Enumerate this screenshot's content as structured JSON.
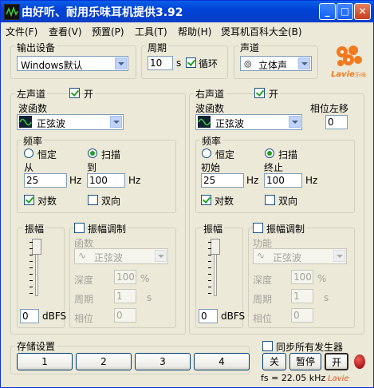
{
  "window": {
    "title": "由好听、耐用乐味耳机提供3.92"
  },
  "menu": [
    "文件(F)",
    "查看(V)",
    "预置(P)",
    "工具(T)",
    "帮助(H)",
    "煲耳机百科大全(B)"
  ],
  "output_device": {
    "group_label": "输出设备",
    "value": "Windows默认"
  },
  "period": {
    "group_label": "周期",
    "value": "10",
    "unit": "s",
    "loop_label": "循环",
    "loop_checked": true
  },
  "channel": {
    "group_label": "声道",
    "value": "立体声"
  },
  "logo": {
    "text": "Lavie",
    "small": "乐味"
  },
  "left": {
    "group_label": "左声道",
    "on_label": "开",
    "on_checked": true,
    "waveform_label": "波函数",
    "waveform_value": "正弦波",
    "freq_label": "频率",
    "const_label": "恒定",
    "sweep_label": "扫描",
    "sweep_selected": true,
    "from_label": "从",
    "to_label": "到",
    "from_value": "25",
    "to_value": "100",
    "hz": "Hz",
    "log_label": "对数",
    "log_checked": true,
    "bidir_label": "双向",
    "bidir_checked": false,
    "amp_label": "振幅",
    "amp_value": "0",
    "dbfs": "dBFS",
    "ampmod_label": "振幅调制",
    "ampmod_checked": false,
    "func_label": "函数",
    "func_value": "正弦波",
    "depth_label": "深度",
    "depth_value": "100",
    "percent": "%",
    "mperiod_label": "周期",
    "mperiod_value": "1",
    "s": "s",
    "phase_label": "相位",
    "phase_value": "0"
  },
  "right": {
    "group_label": "右声道",
    "on_label": "开",
    "on_checked": true,
    "waveform_label": "波函数",
    "waveform_value": "正弦波",
    "phase_shift_label": "相位左移",
    "phase_shift_value": "0",
    "freq_label": "频率",
    "const_label": "恒定",
    "sweep_label": "扫描",
    "sweep_selected": true,
    "from_label": "初始",
    "to_label": "终止",
    "from_value": "25",
    "to_value": "100",
    "hz": "Hz",
    "log_label": "对数",
    "log_checked": true,
    "bidir_label": "双向",
    "bidir_checked": false,
    "amp_label": "振幅",
    "amp_value": "0",
    "dbfs": "dBFS",
    "ampmod_label": "振幅调制",
    "ampmod_checked": false,
    "func_label": "功能",
    "func_value": "正弦波",
    "depth_label": "深度",
    "depth_value": "100",
    "percent": "%",
    "mperiod_label": "周期",
    "mperiod_value": "1",
    "s": "s",
    "phase_label": "相位",
    "phase_value": "0"
  },
  "storage": {
    "group_label": "存储设置",
    "buttons": [
      "1",
      "2",
      "3",
      "4"
    ]
  },
  "sync": {
    "label": "同步所有发生器",
    "checked": false
  },
  "controls": {
    "off": "关",
    "pause": "暂停",
    "on": "开"
  },
  "status": {
    "fs": "fs = 22.05 kHz",
    "watermark": "Lavie"
  }
}
